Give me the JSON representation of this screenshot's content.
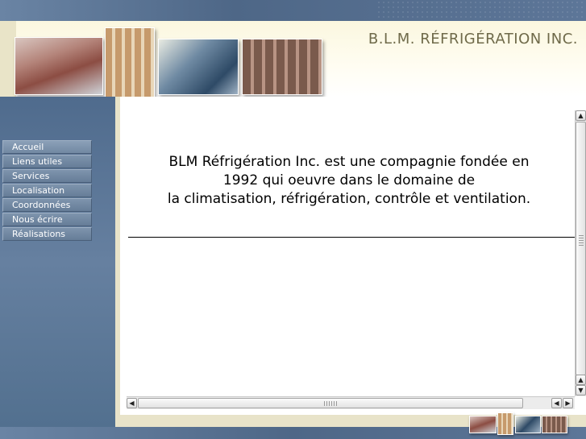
{
  "header": {
    "site_title": "B.L.M. RÉFRIGÉRATION INC."
  },
  "sidebar": {
    "items": [
      {
        "label": "Accueil"
      },
      {
        "label": "Liens utiles"
      },
      {
        "label": "Services"
      },
      {
        "label": "Localisation"
      },
      {
        "label": "Coordonnées"
      },
      {
        "label": "Nous écrire"
      },
      {
        "label": "Réalisations"
      }
    ]
  },
  "main": {
    "intro_line1": "BLM Réfrigération Inc. est une compagnie fondée en",
    "intro_line2": "1992 qui oeuvre dans le domaine de",
    "intro_line3": "la climatisation, réfrigération, contrôle et ventilation."
  },
  "scrollbars": {
    "up_arrow": "▲",
    "down_arrow": "▼",
    "left_arrow": "◀",
    "right_arrow": "▶"
  },
  "colors": {
    "sidebar": "#5b7391",
    "header": "#fbf7df",
    "title_text": "#6f6a4a"
  }
}
